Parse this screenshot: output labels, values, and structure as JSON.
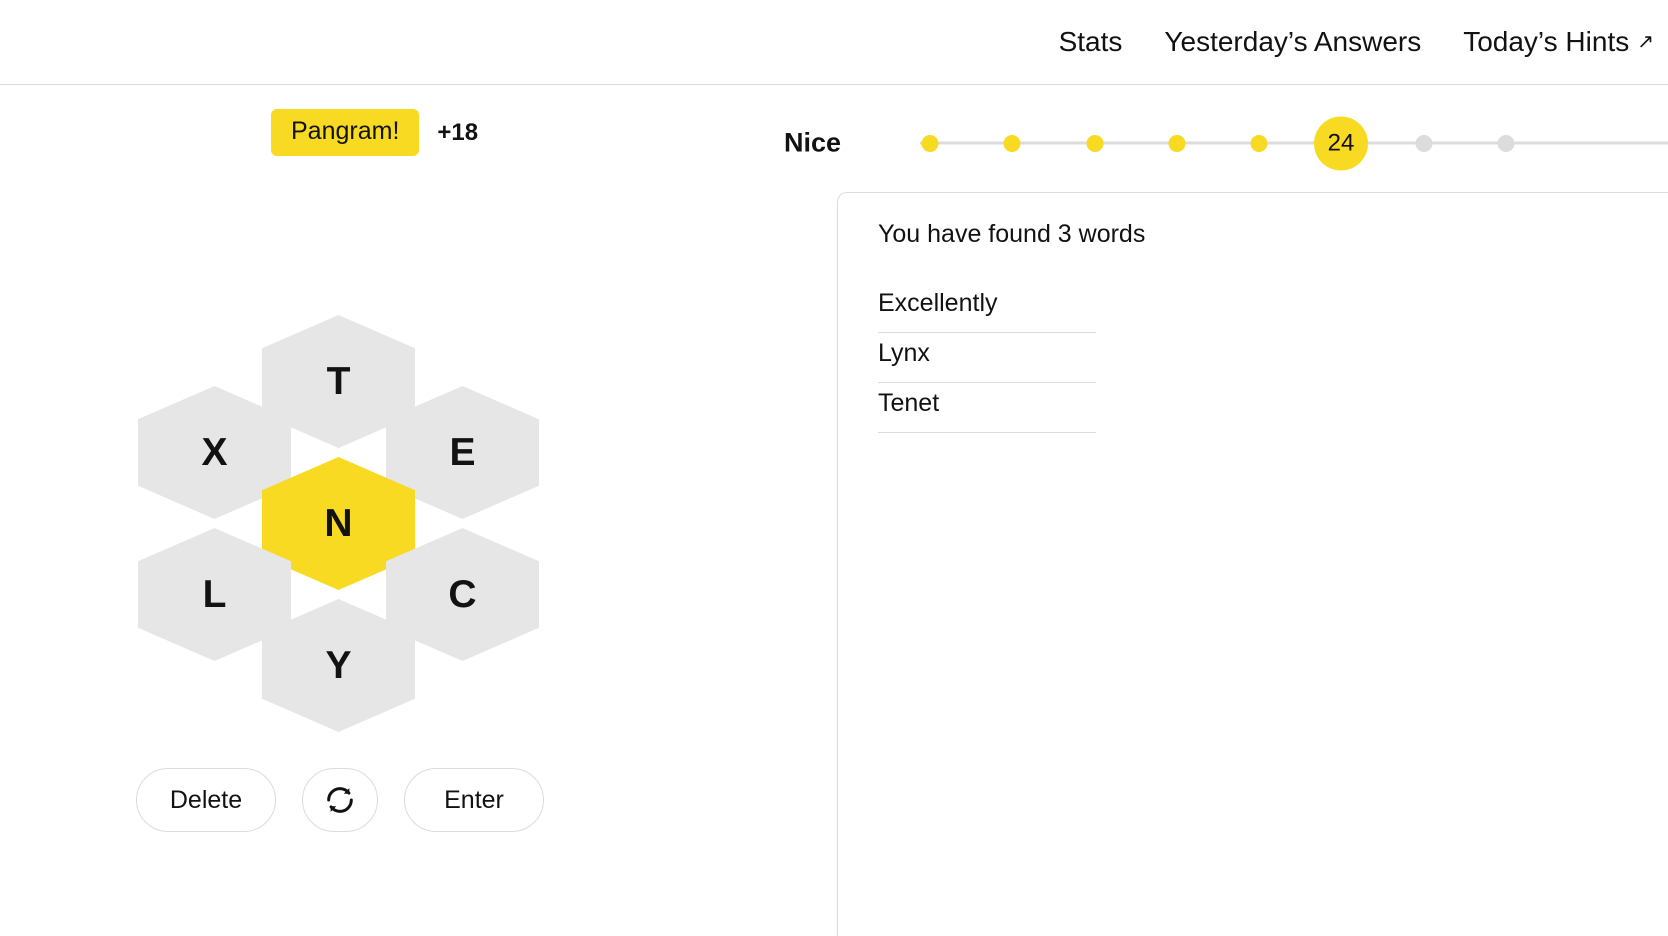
{
  "header": {
    "nav": [
      {
        "label": "Stats",
        "icon": null
      },
      {
        "label": "Yesterday’s Answers",
        "icon": null
      },
      {
        "label": "Today’s Hints",
        "icon": "external-link-arrow-icon",
        "arrow": "↗"
      }
    ]
  },
  "message": {
    "pangram_label": "Pangram!",
    "points": "+18"
  },
  "hive": {
    "center": {
      "letter": "N",
      "is_center": true
    },
    "outer": [
      {
        "letter": "T",
        "position": "top"
      },
      {
        "letter": "E",
        "position": "top-right"
      },
      {
        "letter": "C",
        "position": "bottom-right"
      },
      {
        "letter": "Y",
        "position": "bottom"
      },
      {
        "letter": "L",
        "position": "bottom-left"
      },
      {
        "letter": "X",
        "position": "top-left"
      }
    ]
  },
  "controls": {
    "delete_label": "Delete",
    "shuffle_icon": "shuffle-refresh-icon",
    "enter_label": "Enter"
  },
  "progress": {
    "rank_label": "Nice",
    "current_score": "24",
    "dots": [
      {
        "state": "done"
      },
      {
        "state": "done"
      },
      {
        "state": "done"
      },
      {
        "state": "done"
      },
      {
        "state": "done"
      },
      {
        "state": "current",
        "label": "24"
      },
      {
        "state": "todo"
      },
      {
        "state": "todo"
      }
    ]
  },
  "wordlist": {
    "found_text": "You have found 3 words",
    "words": [
      "Excellently",
      "Lynx",
      "Tenet"
    ]
  },
  "colors": {
    "accent_yellow": "#f7da21",
    "hex_gray": "#e6e6e6",
    "border_gray": "#dcdcdc",
    "text": "#121212"
  }
}
